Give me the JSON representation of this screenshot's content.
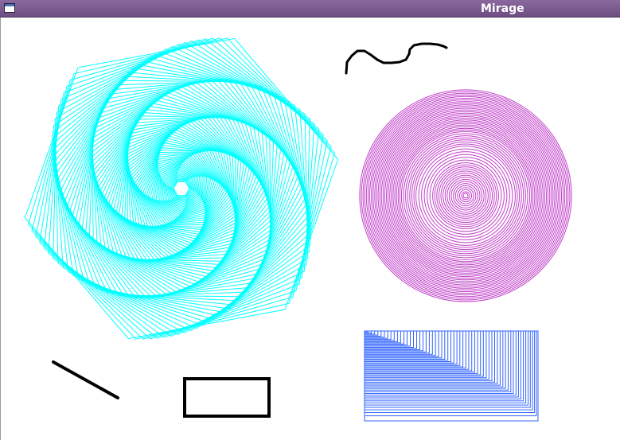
{
  "window": {
    "title": "Mirage",
    "menu_icon": "window-menu-icon"
  },
  "canvas": {
    "background": "#ffffff",
    "shapes": [
      {
        "name": "spiral-hexagon",
        "color": "#00ffff"
      },
      {
        "name": "concentric-circles",
        "color": "#c040c8"
      },
      {
        "name": "nested-rectangles",
        "color": "#3366ff"
      },
      {
        "name": "freehand-squiggle",
        "color": "#000000"
      },
      {
        "name": "diagonal-line",
        "color": "#000000"
      },
      {
        "name": "outlined-rectangle",
        "color": "#000000"
      }
    ]
  }
}
